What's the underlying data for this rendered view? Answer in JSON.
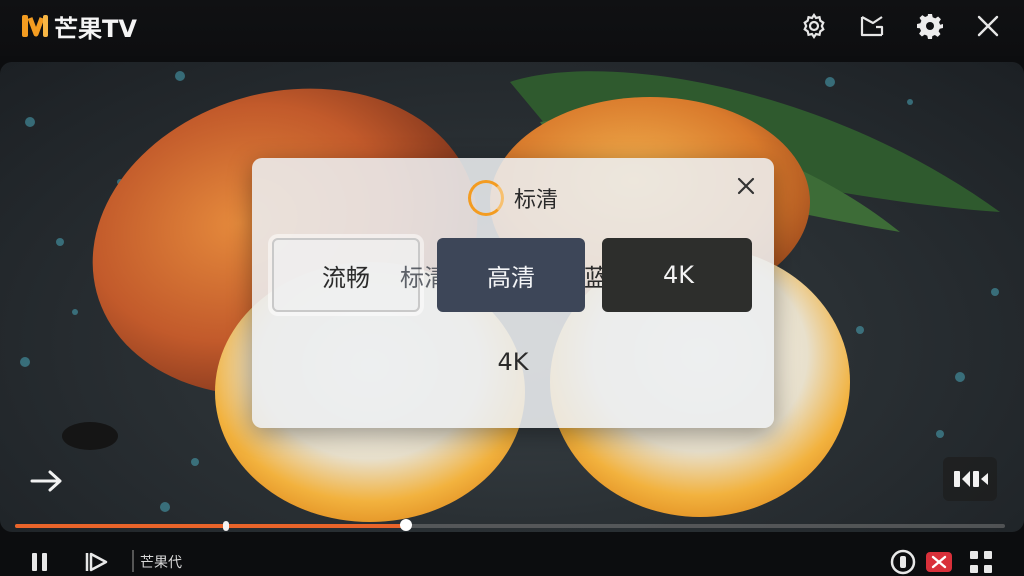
{
  "app": {
    "logo_text": "芒果TV",
    "brand_color": "#f39c21"
  },
  "header": {
    "icons": [
      "settings-gear-outline-icon",
      "picture-in-picture-icon",
      "settings-gear-icon",
      "close-icon"
    ]
  },
  "dialog": {
    "title": "标清",
    "options": [
      {
        "label": "流畅"
      },
      {
        "label": "标清"
      },
      {
        "label": "高清"
      },
      {
        "label": "蓝光"
      },
      {
        "label": "4K"
      }
    ],
    "standalone_option": "4K"
  },
  "player": {
    "progress_fraction": 0.395,
    "bottom_label": "芒果代"
  }
}
